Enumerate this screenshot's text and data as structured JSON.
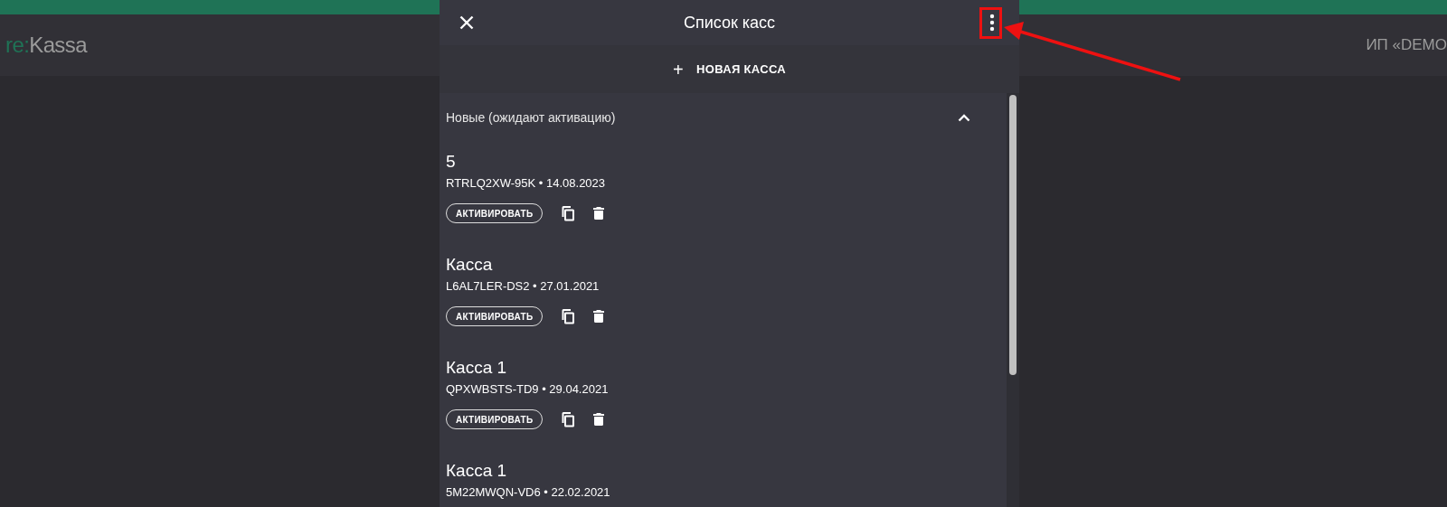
{
  "app_header": {
    "logo_prefix": "re:",
    "logo_name": "Kassa",
    "company": "ИП «DEMO"
  },
  "panel": {
    "title": "Список касс",
    "new_button": {
      "icon": "+",
      "label": "НОВАЯ КАССА"
    },
    "section": {
      "label": "Новые (ожидают активацию)",
      "expanded": true
    },
    "items": [
      {
        "name": "5",
        "details": "RTRLQ2XW-95K • 14.08.2023",
        "action": "АКТИВИРОВАТЬ"
      },
      {
        "name": "Касса",
        "details": "L6AL7LER-DS2 • 27.01.2021",
        "action": "АКТИВИРОВАТЬ"
      },
      {
        "name": "Касса 1",
        "details": "QPXWBSTS-TD9 • 29.04.2021",
        "action": "АКТИВИРОВАТЬ"
      },
      {
        "name": "Касса 1",
        "details": "5M22MWQN-VD6 • 22.02.2021"
      }
    ]
  }
}
